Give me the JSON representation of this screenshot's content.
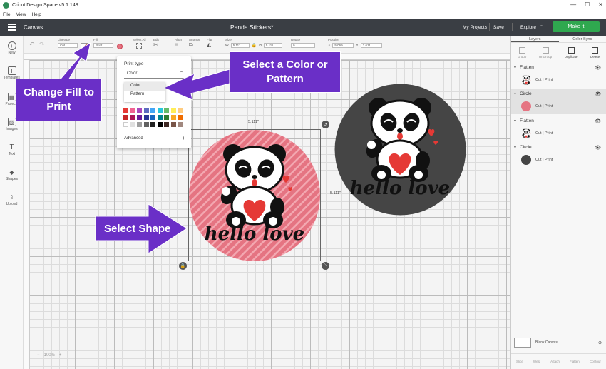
{
  "window": {
    "title": "Cricut Design Space  v5.1.148",
    "menu": [
      "File",
      "View",
      "Help"
    ],
    "controls": [
      "—",
      "☐",
      "✕"
    ]
  },
  "header": {
    "canvas_label": "Canvas",
    "project_title": "Panda Stickers*",
    "my_projects": "My Projects",
    "save": "Save",
    "explore": "Explore",
    "explore_caret": "⌄",
    "make_it": "Make It"
  },
  "toolbar": {
    "linetype_label": "Linetype",
    "linetype_value": "Cut",
    "fill_label": "Fill",
    "fill_value": "Print",
    "select_all_label": "Select All",
    "edit_label": "Edit",
    "align_label": "Align",
    "arrange_label": "Arrange",
    "flip_label": "Flip",
    "size_label": "Size",
    "size_w": "5.111",
    "size_h": "5.111",
    "rotate_label": "Rotate",
    "rotate_value": "0",
    "position_label": "Position",
    "position_x": "5.069",
    "position_y": "2.611",
    "w_prefix": "W",
    "h_prefix": "H",
    "x_prefix": "X",
    "y_prefix": "Y"
  },
  "tools": [
    {
      "label": "New",
      "icon": "+"
    },
    {
      "label": "Templates",
      "icon": "T"
    },
    {
      "label": "Projects",
      "icon": "▦"
    },
    {
      "label": "Images",
      "icon": "▧"
    },
    {
      "label": "Text",
      "icon": "T"
    },
    {
      "label": "Shapes",
      "icon": "◆"
    },
    {
      "label": "Upload",
      "icon": "⇪"
    }
  ],
  "popup": {
    "title": "Print type",
    "selected": "Color",
    "caret": "⌃",
    "options": [
      "Color",
      "Pattern"
    ],
    "advanced": "Advanced",
    "plus": "+"
  },
  "swatch_colors": [
    [
      "#e53935",
      "#f06292",
      "#ab47bc",
      "#5c6bc0",
      "#42a5f5",
      "#26c6da",
      "#66bb6a",
      "#ffee58",
      "#ffcc80"
    ],
    [
      "#c62828",
      "#ad1457",
      "#6a1b9a",
      "#283593",
      "#1565c0",
      "#00838f",
      "#2e7d32",
      "#f9a825",
      "#ef6c00"
    ],
    [
      "#ffffff",
      "#e0e0e0",
      "#9e9e9e",
      "#616161",
      "#212121",
      "#000000",
      "#3e2723",
      "#795548",
      "#a1887f"
    ]
  ],
  "callouts": {
    "fill": "Change Fill to Print",
    "color": "Select a Color or Pattern",
    "shape": "Select Shape"
  },
  "canvas": {
    "width_label": "5.111\"",
    "height_label": "5.111\"",
    "sticker_text": "hello love",
    "zoom": "100%",
    "zoom_minus": "−",
    "zoom_plus": "+"
  },
  "colors": {
    "accent_purple": "#6a2fc7",
    "make_it_green": "#2fa84f",
    "header_dark": "#3a3e44",
    "pink_circle": "#e57482",
    "gray_circle": "#454545"
  },
  "layers_panel": {
    "tabs": [
      "Layers",
      "Color Sync"
    ],
    "actions": [
      "Group",
      "UnGroup",
      "Duplicate",
      "Delete"
    ],
    "items": [
      {
        "name": "Flatten",
        "sub": "Cut | Print"
      },
      {
        "name": "Circle",
        "sub": "Cut | Print"
      },
      {
        "name": "Flatten",
        "sub": "Cut | Print"
      },
      {
        "name": "Circle",
        "sub": "Cut | Print"
      }
    ],
    "blank_canvas": "Blank Canvas",
    "bottom_actions": [
      "Slice",
      "Weld",
      "Attach",
      "Flatten",
      "Contour"
    ]
  }
}
